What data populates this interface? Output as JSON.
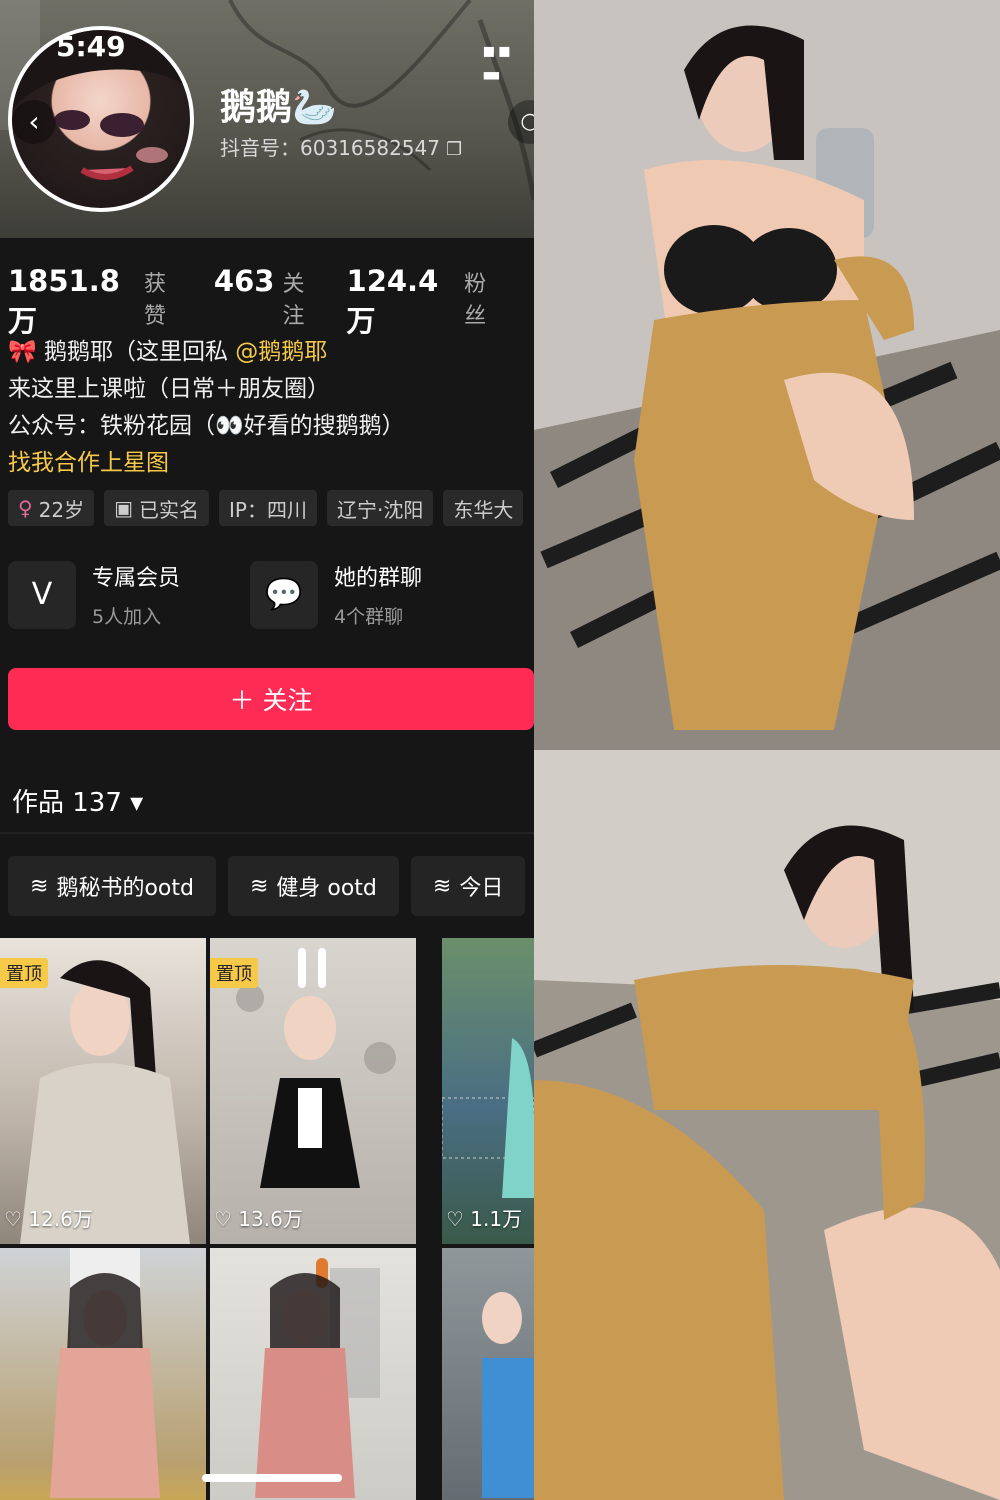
{
  "status": {
    "time": "5:49",
    "icons": "▪▪ ▬"
  },
  "profile": {
    "name": "鹅鹅🦢",
    "douyin_id": "抖音号：60316582547"
  },
  "stats": [
    {
      "num": "1851.8万",
      "label": "获赞"
    },
    {
      "num": "463",
      "label": "关注"
    },
    {
      "num": "124.4万",
      "label": "粉丝"
    }
  ],
  "bio": {
    "line1_prefix": "🎀 鹅鹅耶（这里回私 ",
    "line1_mention": "@鹅鹅耶",
    "line2": "来这里上课啦（日常＋朋友圈）",
    "line3": "公众号：铁粉花园（👀好看的搜鹅鹅）",
    "line4": "找我合作上星图"
  },
  "tags": [
    {
      "icon": "♀",
      "text": "22岁"
    },
    {
      "icon": "▣",
      "text": "已实名"
    },
    {
      "icon": "",
      "text": "IP：四川"
    },
    {
      "icon": "",
      "text": "辽宁·沈阳"
    },
    {
      "icon": "",
      "text": "东华大"
    }
  ],
  "services": [
    {
      "icon": "V",
      "title": "专属会员",
      "sub": "5人加入"
    },
    {
      "icon": "💬",
      "title": "她的群聊",
      "sub": "4个群聊"
    }
  ],
  "follow_label": "＋ 关注",
  "works": {
    "title": "作品 137 ▾"
  },
  "collections": [
    {
      "label": "鹅秘书的ootd"
    },
    {
      "label": "健身 ootd"
    },
    {
      "label": "今日"
    }
  ],
  "videos": [
    {
      "pin": "置顶",
      "likes": "♡ 12.6万"
    },
    {
      "pin": "置顶",
      "likes": "♡ 13.6万"
    },
    {
      "pin": "",
      "likes": "♡ 1.1万"
    },
    {
      "pin": "",
      "likes": ""
    },
    {
      "pin": "",
      "likes": ""
    },
    {
      "pin": "",
      "likes": ""
    }
  ],
  "colors": {
    "accent": "#fe2c55",
    "highlight": "#f7c948",
    "background": "#161616"
  }
}
